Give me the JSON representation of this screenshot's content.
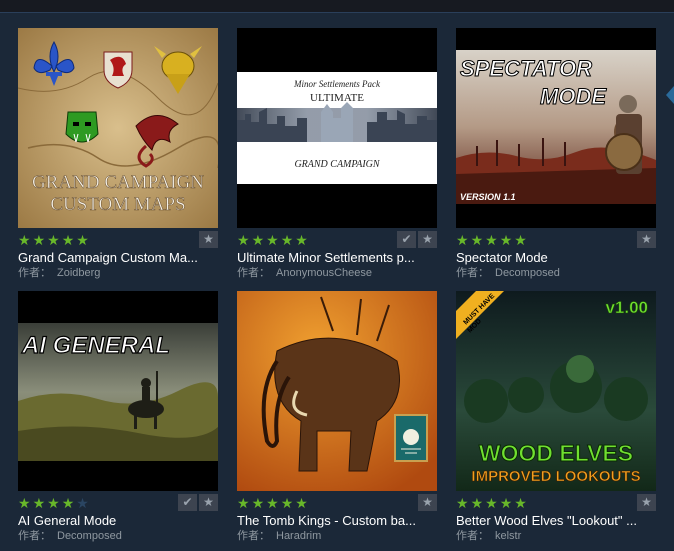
{
  "author_prefix": "作者：",
  "items": [
    {
      "title": "Grand Campaign Custom Ma...",
      "author": "Zoidberg",
      "rating": 5,
      "thumb_text": [
        "GRAND CAMPAIGN",
        "CUSTOM MAPS"
      ]
    },
    {
      "title": "Ultimate Minor Settlements p...",
      "author": "AnonymousCheese",
      "rating": 5,
      "thumb_text": [
        "Minor Settlements Pack",
        "ULTIMATE",
        "GRAND CAMPAIGN"
      ]
    },
    {
      "title": "Spectator Mode",
      "author": "Decomposed",
      "rating": 5,
      "thumb_text": [
        "SPECTATOR",
        "MODE",
        "VERSION 1.1"
      ]
    },
    {
      "title": "AI General Mode",
      "author": "Decomposed",
      "rating": 4,
      "thumb_text": [
        "AI GENERAL"
      ]
    },
    {
      "title": "The Tomb Kings - Custom ba...",
      "author": "Haradrim",
      "rating": 5,
      "thumb_text": []
    },
    {
      "title": "Better Wood Elves \"Lookout\" ...",
      "author": "kelstr",
      "rating": 5,
      "thumb_text": [
        "v1.00",
        "MUST HAVE",
        "MOD",
        "WOOD ELVES",
        "IMPROVED LOOKOUTS"
      ]
    }
  ],
  "colors": {
    "star_on": "#68b72a",
    "star_off": "#2a4562",
    "background": "#1b2838",
    "title": "#ffffff",
    "author": "#8f98a0"
  }
}
